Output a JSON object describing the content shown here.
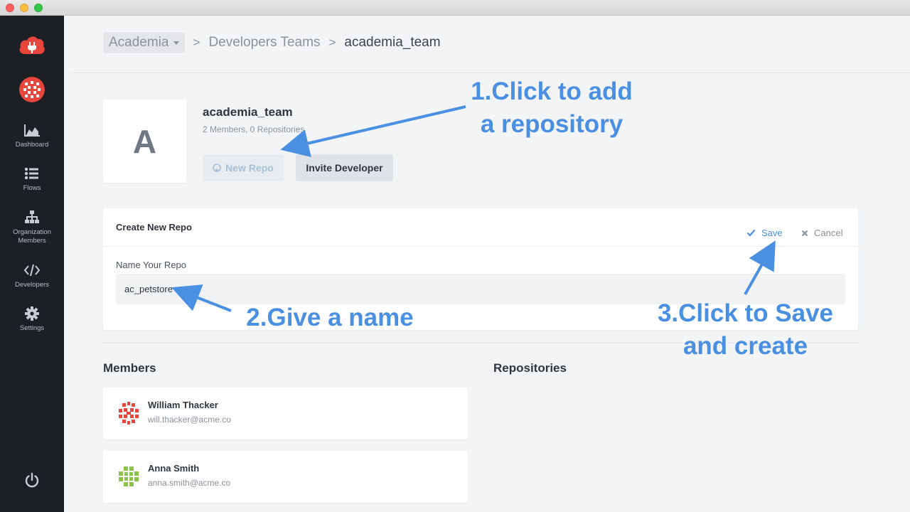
{
  "breadcrumb": {
    "org": "Academia",
    "separator": ">",
    "section": "Developers Teams",
    "current": "academia_team"
  },
  "sidebar": {
    "items": [
      {
        "label": "Dashboard",
        "icon": "area-chart-icon"
      },
      {
        "label": "Flows",
        "icon": "list-icon"
      },
      {
        "label": "Organization Members",
        "icon": "sitemap-icon"
      },
      {
        "label": "Developers",
        "icon": "code-icon"
      },
      {
        "label": "Settings",
        "icon": "gear-icon"
      }
    ],
    "bottom_icon": "power-icon"
  },
  "team": {
    "initial": "A",
    "name": "academia_team",
    "meta": "2 Members, 0 Repositories",
    "new_repo_label": "New Repo",
    "invite_label": "Invite Developer"
  },
  "create_repo": {
    "title": "Create New Repo",
    "save_label": "Save",
    "cancel_label": "Cancel",
    "field_label": "Name Your Repo",
    "field_value": "ac_petstore"
  },
  "members_heading": "Members",
  "repositories_heading": "Repositories",
  "members": [
    {
      "name": "William Thacker",
      "email": "will.thacker@acme.co",
      "avatar_color": "#e8453c"
    },
    {
      "name": "Anna Smith",
      "email": "anna.smith@acme.co",
      "avatar_color": "#8bc34a"
    }
  ],
  "annotations": {
    "step1_line1": "1.Click to add",
    "step1_line2": "a repository",
    "step2": "2.Give a name",
    "step3_line1": "3.Click to Save",
    "step3_line2": "and create"
  },
  "colors": {
    "accent": "#4a90e2",
    "sidebar": "#1c1f23",
    "brand_red": "#e8453c"
  }
}
